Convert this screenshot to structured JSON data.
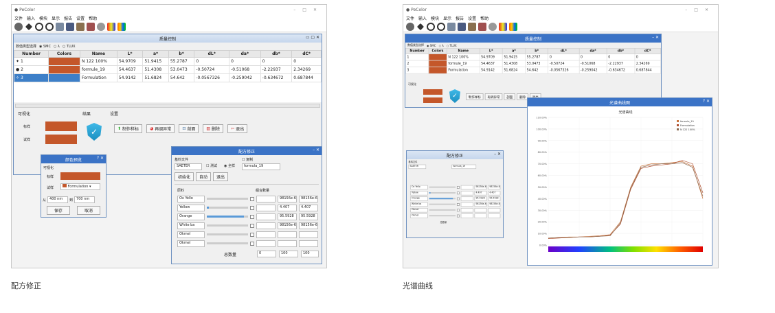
{
  "captions": [
    "配方修正",
    "光谱曲线"
  ],
  "app": {
    "title": "PeColor",
    "menu": [
      "文件",
      "输入",
      "模块",
      "显示",
      "报告",
      "设置",
      "帮助"
    ]
  },
  "quality_window": {
    "title": "质量控制",
    "mode_label": "数值类型选择",
    "modes": [
      "SMC",
      "λ",
      "TLUX"
    ],
    "columns": [
      "Number",
      "Colors",
      "Name",
      "L*",
      "a*",
      "b*",
      "dL*",
      "da*",
      "db*",
      "dC*"
    ],
    "rows": [
      {
        "num": "1",
        "name": "N 122 100%",
        "v": [
          "54.9709",
          "51.9415",
          "55.2787",
          "0",
          "0",
          "0",
          "0"
        ]
      },
      {
        "num": "2",
        "name": "formule_19",
        "v": [
          "54.4637",
          "51.4308",
          "53.0473",
          "-0.50724",
          "-0.51068",
          "-2.22937",
          "2.34269"
        ]
      },
      {
        "num": "3",
        "name": "Formulation",
        "v": [
          "54.9142",
          "51.6824",
          "54.642",
          "-0.0567326",
          "-0.259042",
          "-0.634672",
          "0.687844"
        ]
      }
    ],
    "lower": {
      "visual_label": "可视化",
      "standard_label": "标样",
      "trial_label": "试样",
      "result_label": "结果",
      "settings_label": "设置",
      "buttons": [
        "制作样标",
        "再调异常",
        "剖面",
        "删除",
        "退出"
      ]
    }
  },
  "correction_dialog": {
    "title": "颜色预览",
    "visual": "可视化",
    "standard": "标样",
    "trial": "试样",
    "trial_value": "Formulation",
    "from": "从",
    "from_value": "400 nm",
    "to": "到",
    "to_value": "700 nm",
    "save": "保存",
    "cancel": "取消"
  },
  "recipe_window": {
    "title": "配方修正",
    "file_label": "基料文件",
    "file_value": "SAETER",
    "opt1": "测试",
    "opt2": "全样",
    "copy": "复制",
    "formula_value": "formula_19",
    "buttons": [
      "初始化",
      "自动",
      "退出"
    ],
    "col_material": "原料",
    "col_amount": "組合數量",
    "materials": [
      {
        "name": "Ox Yello",
        "a": "98156e-6",
        "b": "98156e-6",
        "level": 0
      },
      {
        "name": "Yellow",
        "a": "4.407",
        "b": "4.407",
        "level": 0.05
      },
      {
        "name": "Orange",
        "a": "95.5928",
        "b": "95.5928",
        "level": 0.9
      },
      {
        "name": "White ba",
        "a": "98156e-6",
        "b": "98156e-6",
        "level": 0
      },
      {
        "name": "Okmel",
        "a": "",
        "b": "",
        "level": 0
      },
      {
        "name": "Okmel",
        "a": "",
        "b": "",
        "level": 0
      }
    ],
    "total_label": "总数量",
    "totals": [
      "0",
      "100",
      "100"
    ]
  },
  "spectrum_window": {
    "title": "光谱曲线图",
    "chart_title": "光谱曲线",
    "legend": [
      "formule_19",
      "Formulation",
      "N 122 100%"
    ]
  },
  "chart_data": {
    "type": "line",
    "title": "光谱曲线",
    "x": [
      400,
      420,
      440,
      460,
      480,
      500,
      520,
      540,
      560,
      580,
      600,
      620,
      640,
      660,
      680,
      700
    ],
    "ylim": [
      0,
      110
    ],
    "yticks": [
      "110.00%",
      "100.00%",
      "90.00%",
      "80.00%",
      "70.00%",
      "60.00%",
      "50.00%",
      "40.00%",
      "30.00%",
      "20.00%",
      "10.00%",
      "0.00%"
    ],
    "series": [
      {
        "name": "formule_19",
        "values": [
          6,
          6.5,
          7,
          7,
          7.5,
          8,
          9,
          20,
          50,
          68,
          70,
          70,
          71,
          72,
          68,
          40
        ]
      },
      {
        "name": "Formulation",
        "values": [
          5.5,
          6,
          6.5,
          7,
          7,
          7.5,
          8.5,
          18,
          48,
          66,
          68,
          69,
          70,
          73,
          70,
          45
        ]
      },
      {
        "name": "N 122 100%",
        "values": [
          6,
          6.5,
          6.5,
          7,
          7,
          7.5,
          8,
          19,
          49,
          67,
          69,
          70,
          70,
          71,
          67,
          42
        ]
      }
    ],
    "colors": [
      "#c9743d",
      "#b05030",
      "#8c6a50"
    ]
  }
}
